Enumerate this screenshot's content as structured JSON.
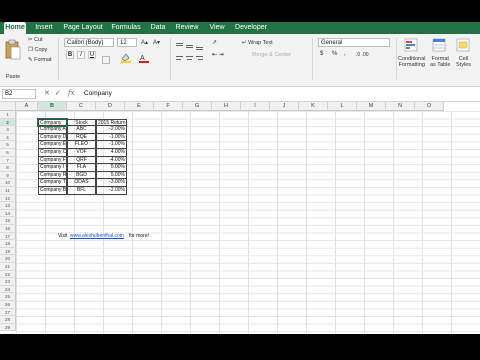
{
  "ribbon": {
    "tabs": [
      "Home",
      "Insert",
      "Page Layout",
      "Formulas",
      "Data",
      "Review",
      "View",
      "Developer"
    ],
    "paste_label": "Paste",
    "cut_label": "Cut",
    "copy_label": "Copy",
    "format_label": "Format",
    "font_name": "Calibri (Body)",
    "font_size": "12",
    "wrap_text_label": "Wrap Text",
    "number_format": "General",
    "merge_center_label": "Merge & Center",
    "currency_symbol": "$",
    "percent_symbol": "%",
    "comma_symbol": ",",
    "conditional_formatting_label": [
      "Conditional",
      "Formatting"
    ],
    "format_as_table_label": [
      "Format",
      "as Table"
    ],
    "cell_styles_label": [
      "Cell",
      "Styles"
    ],
    "bold": "B",
    "italic": "I",
    "underline": "U"
  },
  "formula_bar": {
    "name_box": "B2",
    "fx": "fx",
    "content": "Company"
  },
  "columns": [
    "A",
    "B",
    "C",
    "D",
    "E",
    "F",
    "G",
    "H",
    "I",
    "J",
    "K",
    "L",
    "M",
    "N",
    "O"
  ],
  "rows": [
    "1",
    "2",
    "3",
    "4",
    "5",
    "6",
    "7",
    "8",
    "9",
    "10",
    "11",
    "12",
    "13",
    "14",
    "15",
    "16",
    "17",
    "18",
    "19",
    "20",
    "21",
    "22",
    "23",
    "24",
    "25",
    "26",
    "27",
    "28",
    "29"
  ],
  "table": {
    "headers": [
      "Company",
      "Stock",
      "2015 Return"
    ],
    "rows": [
      [
        "Company A",
        "ABC",
        "-2.00%"
      ],
      [
        "Company D",
        "RQE",
        "-1.00%"
      ],
      [
        "Company E",
        "FLEO",
        "-1.00%"
      ],
      [
        "Company C",
        "VOF",
        "4.00%"
      ],
      [
        "Company F",
        "QRF",
        "-4.00%"
      ],
      [
        "Company I",
        "FLA",
        "5.00%"
      ],
      [
        "Company R",
        "BGD",
        "5.00%"
      ],
      [
        "Company T",
        "ODAS",
        "-3.00%"
      ],
      [
        "Company B",
        "BFL",
        "-2.00%"
      ]
    ]
  },
  "footer_note": {
    "prefix": "Visit",
    "link": "www.alexhubenthal.com",
    "suffix": "for more!"
  },
  "colors": {
    "excel_green": "#217346",
    "link_blue": "#1a4fd6"
  }
}
